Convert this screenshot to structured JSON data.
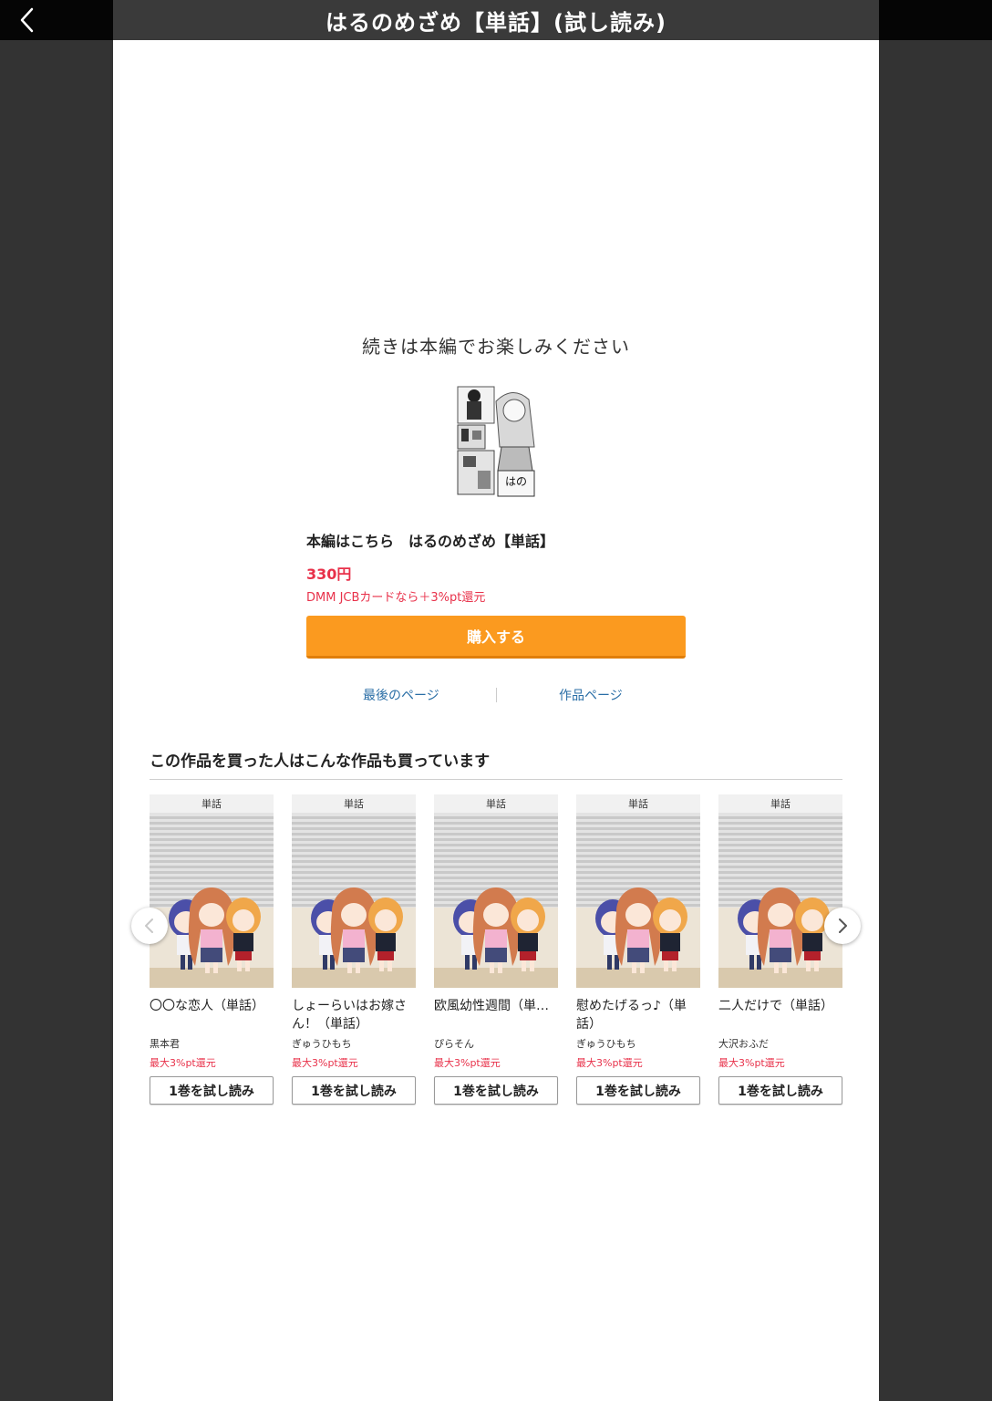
{
  "header": {
    "title": "はるのめざめ【単話】(試し読み)"
  },
  "viewer": {
    "continue_message": "続きは本編でお楽しみください"
  },
  "product": {
    "main_title": "本編はこちら　はるのめざめ【単話】",
    "price": "330円",
    "jcb_note": "DMM JCBカードなら＋3%pt還元",
    "buy_label": "購入する"
  },
  "links": {
    "last_page": "最後のページ",
    "work_page": "作品ページ"
  },
  "recommend": {
    "heading": "この作品を買った人はこんな作品も買っています",
    "items": [
      {
        "badge": "単話",
        "title": "〇〇な恋人（単話）",
        "author": "黒本君",
        "pt": "最大3%pt還元",
        "button": "1巻を試し読み"
      },
      {
        "badge": "単話",
        "title": "しょーらいはお嫁さん！（単話）",
        "author": "ぎゅうひもち",
        "pt": "最大3%pt還元",
        "button": "1巻を試し読み"
      },
      {
        "badge": "単話",
        "title": "欧風幼性週間（単…",
        "author": "ぴらそん",
        "pt": "最大3%pt還元",
        "button": "1巻を試し読み"
      },
      {
        "badge": "単話",
        "title": "慰めたげるっ♪（単話）",
        "author": "ぎゅうひもち",
        "pt": "最大3%pt還元",
        "button": "1巻を試し読み"
      },
      {
        "badge": "単話",
        "title": "二人だけで（単話）",
        "author": "大沢おふだ",
        "pt": "最大3%pt還元",
        "button": "1巻を試し読み"
      }
    ]
  },
  "colors": {
    "accent_orange": "#fb9a1f",
    "price_red": "#e8314a",
    "link_blue": "#2a6ea6"
  },
  "icons": {
    "back": "chevron-left-icon",
    "prev": "chevron-left-icon",
    "next": "chevron-right-icon"
  }
}
